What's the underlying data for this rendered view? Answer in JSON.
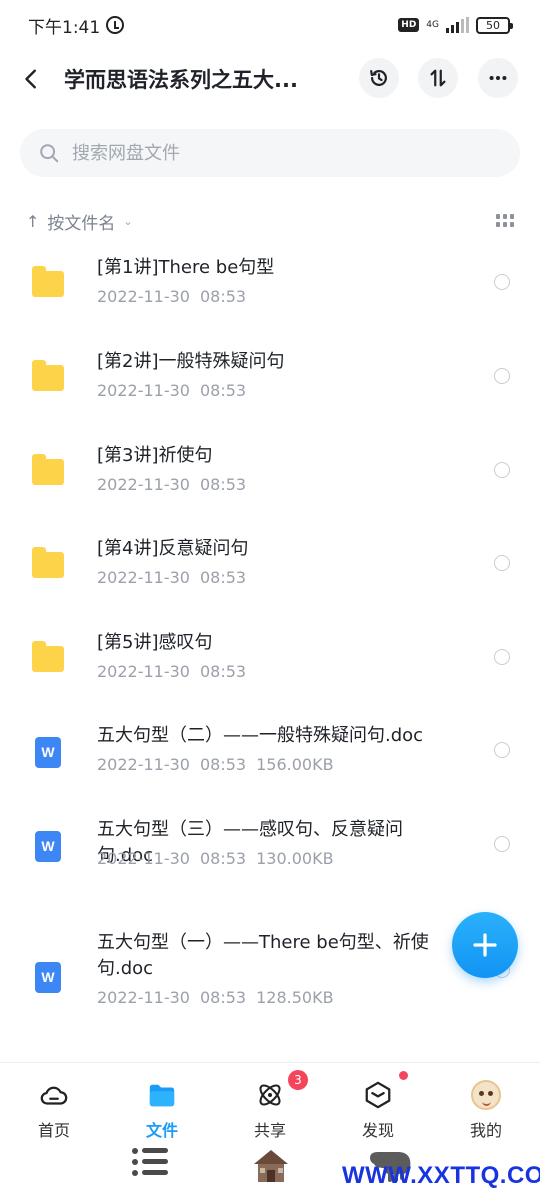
{
  "status_bar": {
    "time": "下午1:41",
    "hd": "HD",
    "network": "4G",
    "network_sub": "4ᴳ",
    "battery": "50"
  },
  "header": {
    "title": "学而思语法系列之五大...",
    "icons": [
      "back-arrow-icon",
      "history-icon",
      "sort-swap-icon",
      "more-icon"
    ]
  },
  "search": {
    "placeholder": "搜索网盘文件"
  },
  "sort": {
    "label": "按文件名"
  },
  "files": [
    {
      "type": "folder",
      "name": "[第1讲]There be句型",
      "date": "2022-11-30",
      "time": "08:53",
      "size": ""
    },
    {
      "type": "folder",
      "name": "[第2讲]一般特殊疑问句",
      "date": "2022-11-30",
      "time": "08:53",
      "size": ""
    },
    {
      "type": "folder",
      "name": "[第3讲]祈使句",
      "date": "2022-11-30",
      "time": "08:53",
      "size": ""
    },
    {
      "type": "folder",
      "name": "[第4讲]反意疑问句",
      "date": "2022-11-30",
      "time": "08:53",
      "size": ""
    },
    {
      "type": "folder",
      "name": "[第5讲]感叹句",
      "date": "2022-11-30",
      "time": "08:53",
      "size": ""
    },
    {
      "type": "doc",
      "icon_letter": "W",
      "name": "五大句型（二）——一般特殊疑问句.doc",
      "date": "2022-11-30",
      "time": "08:53",
      "size": "156.00KB"
    },
    {
      "type": "doc",
      "icon_letter": "W",
      "name": "五大句型（三）——感叹句、反意疑问句.doc",
      "date": "2022-11-30",
      "time": "08:53",
      "size": "130.00KB"
    },
    {
      "type": "doc",
      "icon_letter": "W",
      "name": "五大句型（一）——There be句型、祈使句.doc",
      "date": "2022-11-30",
      "time": "08:53",
      "size": "128.50KB"
    }
  ],
  "bottom_nav": {
    "tabs": [
      {
        "label": "首页"
      },
      {
        "label": "文件"
      },
      {
        "label": "共享",
        "badge": "3"
      },
      {
        "label": "发现"
      },
      {
        "label": "我的"
      }
    ]
  },
  "watermark": "WWW.XXTTQ.COM",
  "colors": {
    "accent": "#1a9cf7",
    "folder": "#fdd34a",
    "doc": "#3c86f5",
    "badge": "#f5455c"
  }
}
